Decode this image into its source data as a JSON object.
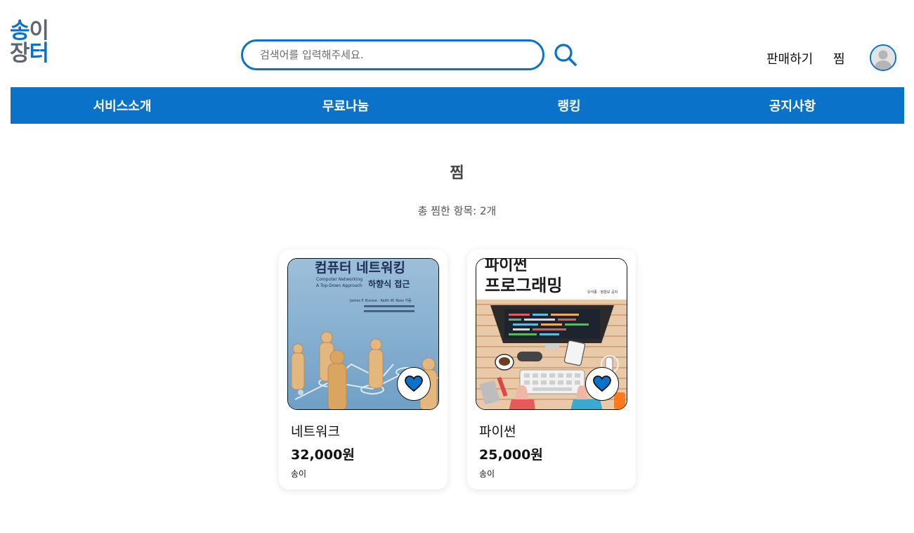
{
  "header": {
    "logo_line1_a": "송",
    "logo_line1_b": "이",
    "logo_line2_a": "장",
    "logo_line2_b": "터",
    "search_placeholder": "검색어를 입력해주세요.",
    "sell_label": "판매하기",
    "wishlist_label": "찜"
  },
  "nav": {
    "items": [
      {
        "label": "서비스소개"
      },
      {
        "label": "무료나눔"
      },
      {
        "label": "랭킹"
      },
      {
        "label": "공지사항"
      }
    ]
  },
  "main": {
    "title": "찜",
    "total_prefix": "총 찜한 항목: ",
    "total_count": "2개"
  },
  "cards": [
    {
      "title": "네트워크",
      "price": "32,000원",
      "seller": "송이",
      "cover_title": "컴퓨터 네트워킹",
      "cover_subtitle_en": "Computer Networking",
      "cover_subtitle_en2": "A Top-Down Approach",
      "cover_subtitle_kr": "하향식 접근",
      "cover_authors": "James F. Kurose · Keith W. Ross 지음"
    },
    {
      "title": "파이썬",
      "price": "25,000원",
      "seller": "송이",
      "cover_title_1": "파이썬",
      "cover_title_2": "프로그래밍",
      "cover_authors": "유석종 · 정형모 공저"
    }
  ],
  "colors": {
    "brand_blue": "#0a72c8",
    "logo_gray": "#5f6672"
  },
  "icons": {
    "search": "search-icon",
    "avatar": "user-avatar-icon",
    "heart": "heart-icon"
  }
}
